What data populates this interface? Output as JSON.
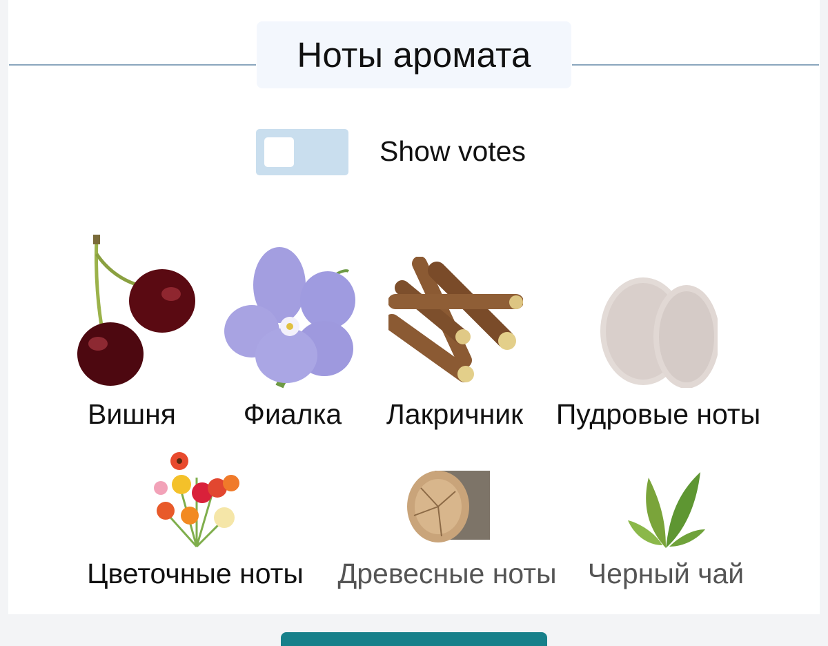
{
  "section": {
    "title": "Ноты аромата"
  },
  "votes_toggle": {
    "label": "Show votes",
    "checked": false
  },
  "notes": [
    {
      "label": "Вишня",
      "icon": "cherry-icon"
    },
    {
      "label": "Фиалка",
      "icon": "violet-flower-icon"
    },
    {
      "label": "Лакричник",
      "icon": "licorice-root-icon"
    },
    {
      "label": "Пудровые ноты",
      "icon": "powder-icon"
    },
    {
      "label": "Цветочные ноты",
      "icon": "flower-bouquet-icon"
    },
    {
      "label": "Древесные ноты",
      "icon": "wood-log-icon"
    },
    {
      "label": "Черный чай",
      "icon": "tea-leaves-icon"
    }
  ],
  "colors": {
    "accent": "#17808a",
    "divider": "#8aa6bd",
    "toggle_track": "#c9deee"
  }
}
